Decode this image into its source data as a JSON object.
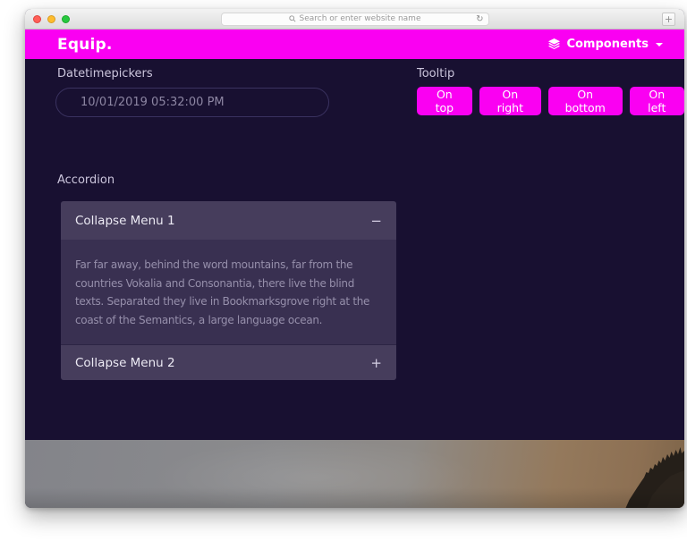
{
  "browser": {
    "search_placeholder": "Search or enter website name",
    "reload_icon": "↻",
    "new_tab_label": "+"
  },
  "navbar": {
    "brand": "Equip.",
    "menu": {
      "label": "Components"
    }
  },
  "main": {
    "datetimepickers": {
      "label": "Datetimepickers",
      "value": "10/01/2019 05:32:00 PM"
    },
    "tooltip": {
      "label": "Tooltip",
      "buttons": [
        {
          "label": "On top"
        },
        {
          "label": "On right"
        },
        {
          "label": "On bottom"
        },
        {
          "label": "On left"
        }
      ]
    },
    "accordion": {
      "label": "Accordion",
      "items": [
        {
          "title": "Collapse Menu 1",
          "toggle": "−",
          "expanded": true,
          "body": "Far far away, behind the word mountains, far from the countries Vokalia and Consonantia, there live the blind texts. Separated they live in Bookmarksgrove right at the coast of the Semantics, a large language ocean."
        },
        {
          "title": "Collapse Menu 2",
          "toggle": "+",
          "expanded": false
        }
      ]
    }
  },
  "colors": {
    "accent": "#fa00f2",
    "page_background": "#181031",
    "accordion_header": "#463d5c",
    "accordion_body": "#393051"
  }
}
